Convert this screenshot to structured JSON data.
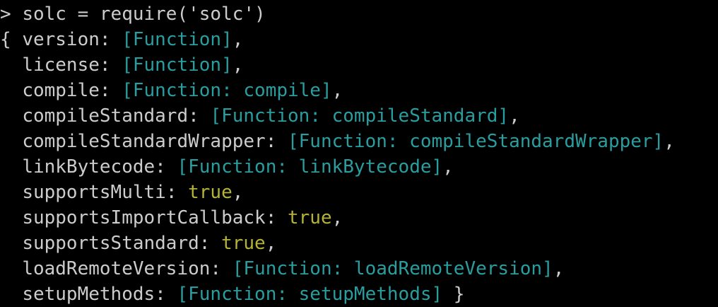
{
  "colors": {
    "background": "#000000",
    "text": "#cccccc",
    "function": "#2a9d9f",
    "boolean": "#b5b238"
  },
  "prompt_line": {
    "prompt": ">",
    "command": "solc = require('solc')"
  },
  "output_lines": [
    {
      "prefix": "{ ",
      "key": "version",
      "value": "[Function]",
      "value_type": "function",
      "suffix": ","
    },
    {
      "prefix": "  ",
      "key": "license",
      "value": "[Function]",
      "value_type": "function",
      "suffix": ","
    },
    {
      "prefix": "  ",
      "key": "compile",
      "value": "[Function: compile]",
      "value_type": "function",
      "suffix": ","
    },
    {
      "prefix": "  ",
      "key": "compileStandard",
      "value": "[Function: compileStandard]",
      "value_type": "function",
      "suffix": ","
    },
    {
      "prefix": "  ",
      "key": "compileStandardWrapper",
      "value": "[Function: compileStandardWrapper]",
      "value_type": "function",
      "suffix": ","
    },
    {
      "prefix": "  ",
      "key": "linkBytecode",
      "value": "[Function: linkBytecode]",
      "value_type": "function",
      "suffix": ","
    },
    {
      "prefix": "  ",
      "key": "supportsMulti",
      "value": "true",
      "value_type": "boolean",
      "suffix": ","
    },
    {
      "prefix": "  ",
      "key": "supportsImportCallback",
      "value": "true",
      "value_type": "boolean",
      "suffix": ","
    },
    {
      "prefix": "  ",
      "key": "supportsStandard",
      "value": "true",
      "value_type": "boolean",
      "suffix": ","
    },
    {
      "prefix": "  ",
      "key": "loadRemoteVersion",
      "value": "[Function: loadRemoteVersion]",
      "value_type": "function",
      "suffix": ","
    },
    {
      "prefix": "  ",
      "key": "setupMethods",
      "value": "[Function: setupMethods]",
      "value_type": "function",
      "suffix": " }"
    }
  ]
}
